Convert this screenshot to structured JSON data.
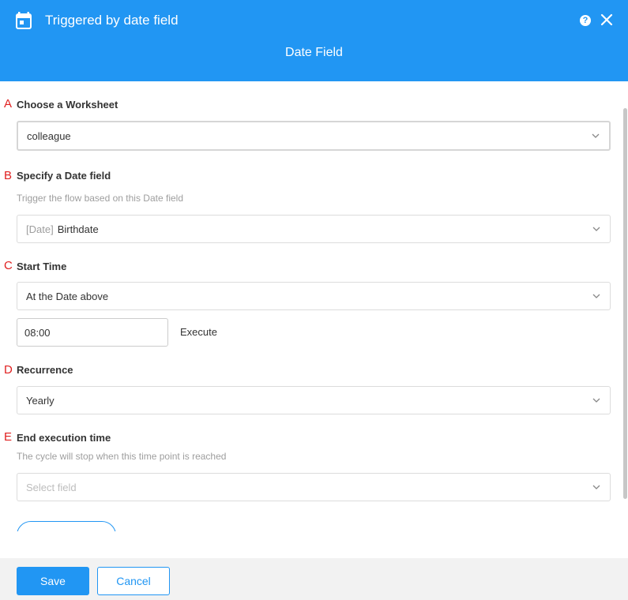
{
  "header": {
    "title": "Triggered by date field",
    "help_glyph": "?",
    "tab": "Date Field",
    "icons": {
      "calendar": "calendar-icon",
      "help": "help-icon",
      "close": "close-icon"
    }
  },
  "sections": {
    "worksheet": {
      "letter": "A",
      "label": "Choose a Worksheet",
      "value": "colleague"
    },
    "date_field": {
      "letter": "B",
      "label": "Specify a Date field",
      "hint": "Trigger the flow based on this Date field",
      "value_prefix": "[Date]",
      "value": "Birthdate"
    },
    "start_time": {
      "letter": "C",
      "label": "Start Time",
      "value": "At the Date above",
      "time": "08:00",
      "execute_label": "Execute"
    },
    "recurrence": {
      "letter": "D",
      "label": "Recurrence",
      "value": "Yearly"
    },
    "end_time": {
      "letter": "E",
      "label": "End execution time",
      "hint": "The cycle will stop when this time point is reached",
      "placeholder": "Select field"
    }
  },
  "footer": {
    "save_label": "Save",
    "cancel_label": "Cancel"
  },
  "colors": {
    "primary": "#2196f3",
    "letter_marker": "#e02020",
    "footer_bg": "#f2f2f2",
    "border": "#dcdcdc",
    "hint_text": "#9e9e9e"
  }
}
